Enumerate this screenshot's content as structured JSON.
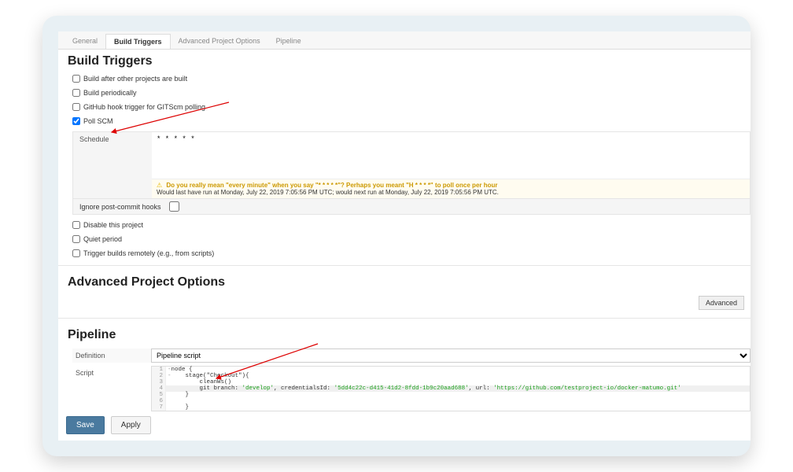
{
  "tabs": {
    "general": "General",
    "build_triggers": "Build Triggers",
    "advanced_options": "Advanced Project Options",
    "pipeline": "Pipeline"
  },
  "build_triggers": {
    "title": "Build Triggers",
    "build_after": "Build after other projects are built",
    "build_periodically": "Build periodically",
    "github_hook": "GitHub hook trigger for GITScm polling",
    "poll_scm": "Poll SCM",
    "schedule_label": "Schedule",
    "schedule_value": "* * * * *",
    "warning": "Do you really mean \"every minute\" when you say \"* * * * *\"? Perhaps you meant \"H * * * *\" to poll once per hour",
    "last_run": "Would last have run at Monday, July 22, 2019 7:05:56 PM UTC; would next run at Monday, July 22, 2019 7:05:56 PM UTC.",
    "ignore_post_commit": "Ignore post-commit hooks",
    "disable_project": "Disable this project",
    "quiet_period": "Quiet period",
    "trigger_remote": "Trigger builds remotely (e.g., from scripts)"
  },
  "advanced": {
    "title": "Advanced Project Options",
    "advanced_btn": "Advanced"
  },
  "pipeline": {
    "title": "Pipeline",
    "definition_label": "Definition",
    "definition_value": "Pipeline script",
    "script_label": "Script",
    "script_lines": [
      {
        "no": "1",
        "fold": "-",
        "indent": "",
        "code": "node {"
      },
      {
        "no": "2",
        "fold": "-",
        "indent": "    ",
        "code": "stage(\"Checkout\"){"
      },
      {
        "no": "3",
        "fold": "",
        "indent": "        ",
        "code": "cleanWs()"
      },
      {
        "no": "4",
        "fold": "",
        "indent": "        ",
        "highlight": true,
        "prefix": "git branch: ",
        "s1": "'develop'",
        "mid1": ", credentialsId: ",
        "s2": "'5dd4c22c-d415-41d2-8fdd-1b9c20aad688'",
        "mid2": ", url: ",
        "s3": "'https://github.com/testproject-io/docker-matumo.git'"
      },
      {
        "no": "5",
        "fold": "",
        "indent": "    ",
        "code": "}"
      },
      {
        "no": "6",
        "fold": "",
        "indent": "",
        "code": ""
      },
      {
        "no": "7",
        "fold": "",
        "indent": "    ",
        "code": "}"
      }
    ]
  },
  "buttons": {
    "save": "Save",
    "apply": "Apply"
  }
}
